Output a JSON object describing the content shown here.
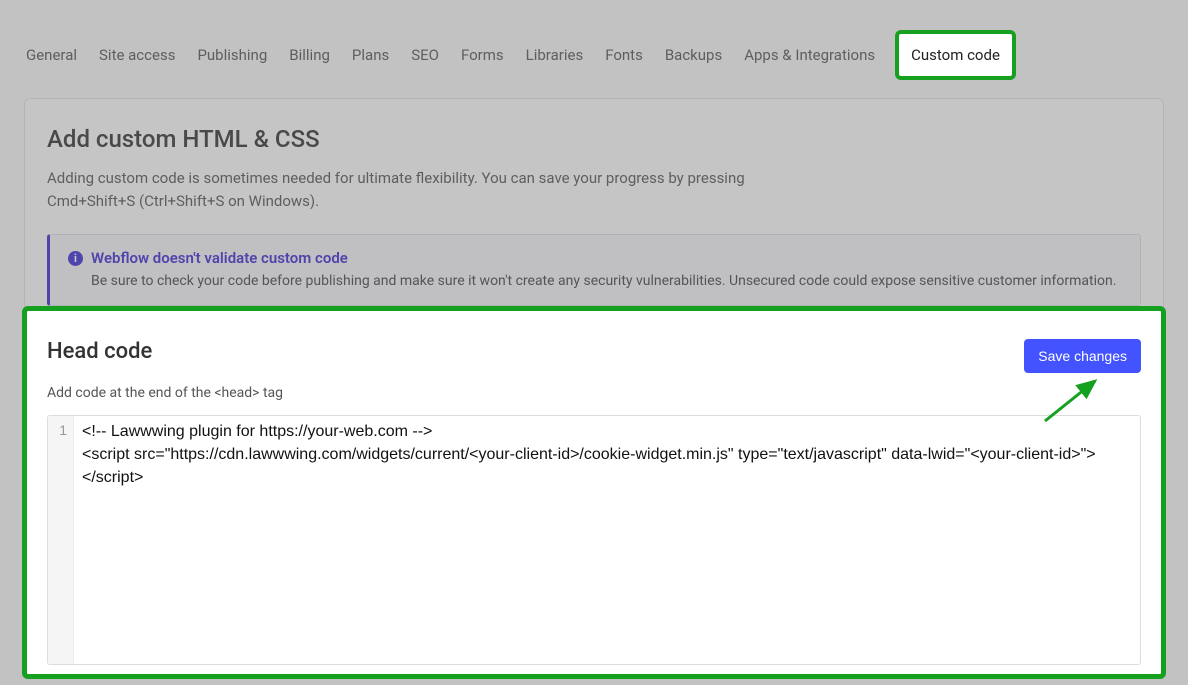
{
  "tabs": {
    "items": [
      "General",
      "Site access",
      "Publishing",
      "Billing",
      "Plans",
      "SEO",
      "Forms",
      "Libraries",
      "Fonts",
      "Backups",
      "Apps & Integrations",
      "Custom code"
    ],
    "active_index": 11
  },
  "panel": {
    "title": "Add custom HTML & CSS",
    "description": "Adding custom code is sometimes needed for ultimate flexibility. You can save your progress by pressing Cmd+Shift+S (Ctrl+Shift+S on Windows)."
  },
  "notice": {
    "title": "Webflow doesn't validate custom code",
    "body": "Be sure to check your code before publishing and make sure it won't create any security vulnerabilities. Unsecured code could expose sensitive customer information."
  },
  "headcode": {
    "title": "Head code",
    "hint": "Add code at the end of the <head> tag",
    "save_label": "Save changes",
    "line_number": "1",
    "code": "<!-- Lawwwing plugin for https://your-web.com -->\n<script src=\"https://cdn.lawwwing.com/widgets/current/<your-client-id>/cookie-widget.min.js\" type=\"text/javascript\" data-lwid=\"<your-client-id>\"></script>"
  },
  "annotations": {
    "highlight_color": "#16a020",
    "arrow_color": "#16a020"
  }
}
